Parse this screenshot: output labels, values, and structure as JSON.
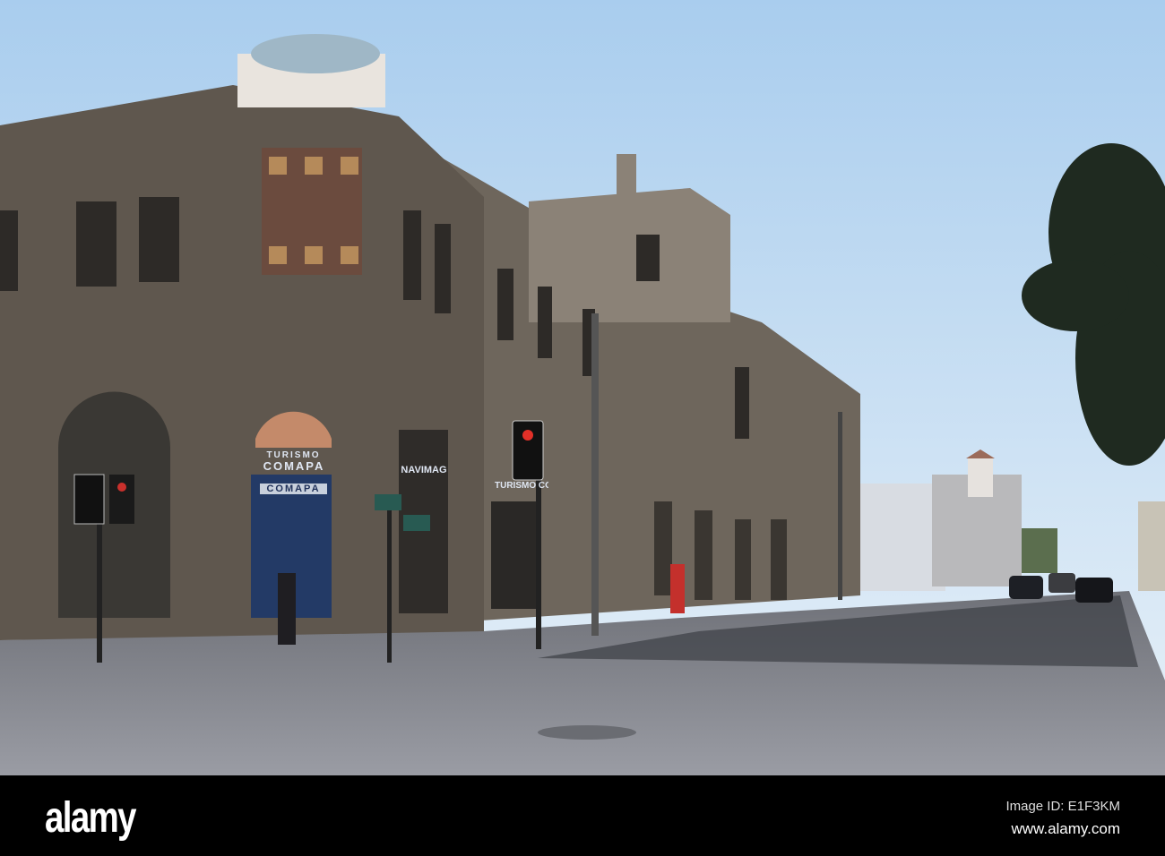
{
  "photo": {
    "signs": {
      "turismo": "TURISMO",
      "comapa": "COMAPA",
      "navimag": "NAVIMAG",
      "turismo_comapa_2": "TURISMO COMAPA",
      "shutter_logo": "COMAPA"
    }
  },
  "footer": {
    "logo": "alamy",
    "image_id": "Image ID: E1F3KM",
    "website": "www.alamy.com"
  },
  "colors": {
    "sky_top": "#a9cdee",
    "sky_bottom": "#e4eff8",
    "stone": "#6b635a",
    "road": "#8a8d95"
  }
}
